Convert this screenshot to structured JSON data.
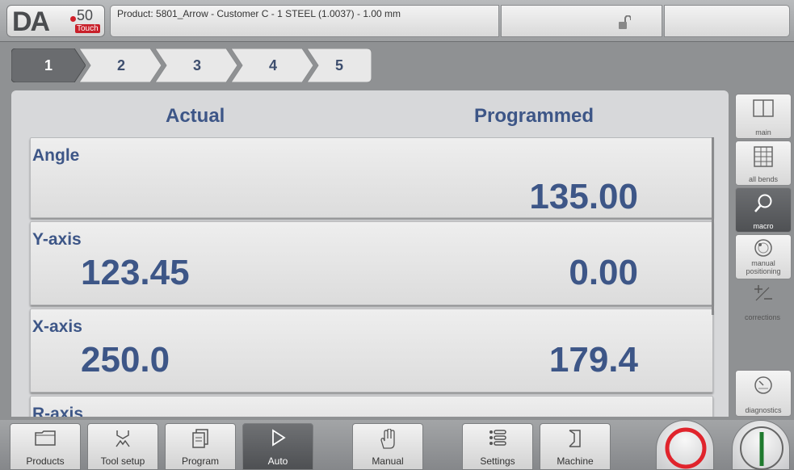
{
  "header": {
    "logo": {
      "brand": "DA",
      "model": "50",
      "sub": "Touch",
      "accent": "#c8202a"
    },
    "product_text": "Product: 5801_Arrow - Customer C - 1 STEEL (1.0037) - 1.00 mm",
    "lock_icon": "unlocked-padlock-icon"
  },
  "tabs": [
    {
      "label": "1",
      "active": true
    },
    {
      "label": "2",
      "active": false
    },
    {
      "label": "3",
      "active": false
    },
    {
      "label": "4",
      "active": false
    },
    {
      "label": "5",
      "active": false
    }
  ],
  "columns": {
    "actual": "Actual",
    "programmed": "Programmed"
  },
  "rows": [
    {
      "label": "Angle",
      "actual": "",
      "programmed": "135.00"
    },
    {
      "label": "Y-axis",
      "actual": "123.45",
      "programmed": "0.00"
    },
    {
      "label": "X-axis",
      "actual": "250.0",
      "programmed": "179.4"
    },
    {
      "label": "R-axis",
      "actual": "",
      "programmed": ""
    }
  ],
  "side": {
    "main": {
      "label": "main",
      "icon": "split-view-icon"
    },
    "all_bends": {
      "label": "all bends",
      "icon": "table-icon"
    },
    "macro": {
      "label": "macro",
      "icon": "magnifier-icon",
      "active": true
    },
    "manual_positioning_1": "manual",
    "manual_positioning_2": "positioning",
    "corrections": {
      "label": "corrections",
      "icon": "plus-minus-icon"
    },
    "diagnostics": {
      "label": "diagnostics",
      "icon": "gauge-icon"
    }
  },
  "nav": {
    "products": "Products",
    "tool_setup": "Tool setup",
    "program": "Program",
    "auto": "Auto",
    "manual": "Manual",
    "settings": "Settings",
    "machine": "Machine"
  },
  "colors": {
    "label_blue": "#3d5687",
    "stop_red": "#e0242c",
    "start_green": "#1f7a2e"
  }
}
